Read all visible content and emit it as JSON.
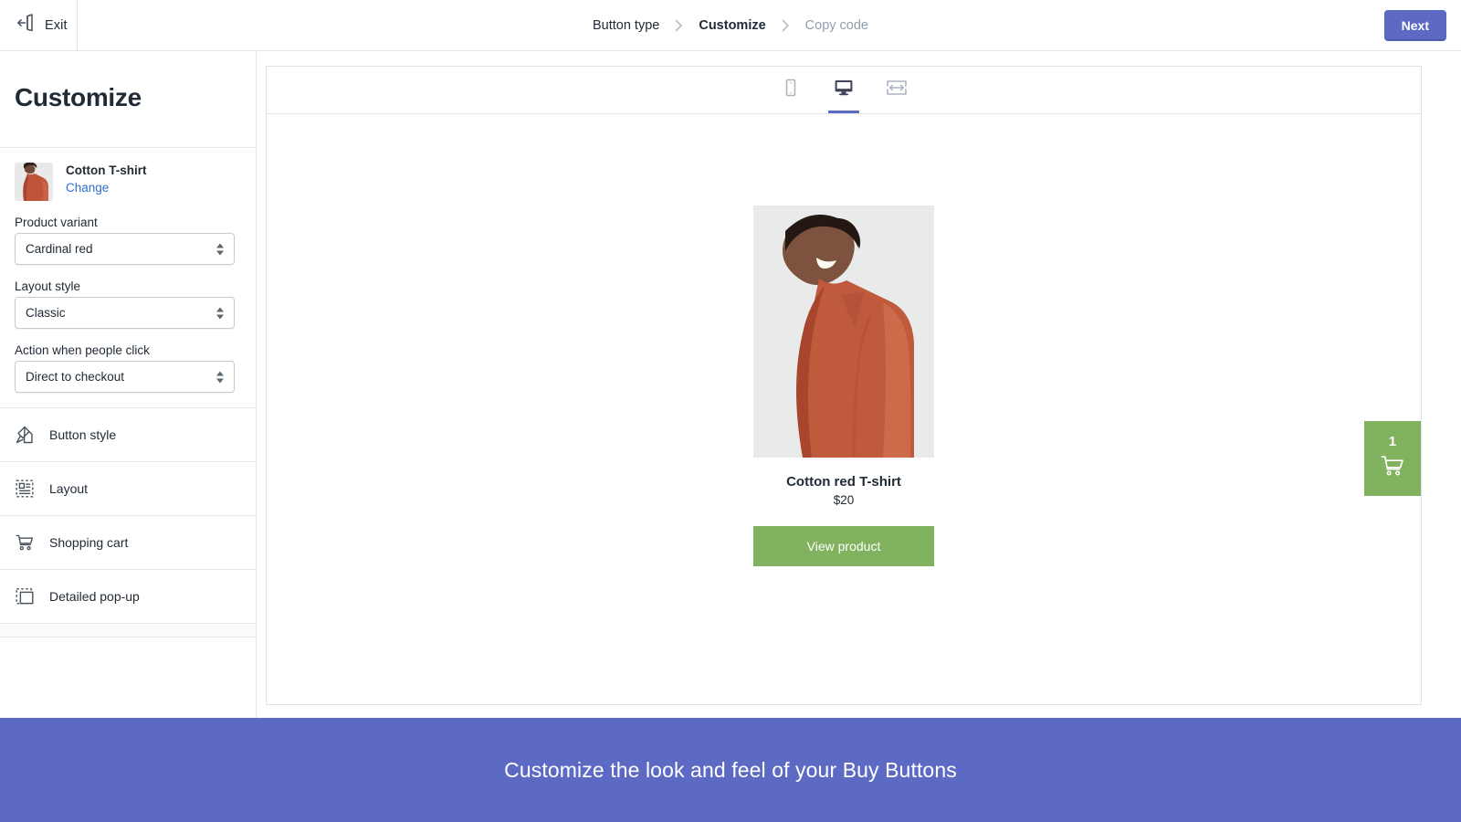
{
  "topbar": {
    "exit_label": "Exit",
    "exit_icon": "exit-door-arrow-icon",
    "next_label": "Next",
    "next_color": "#5c6ac4",
    "breadcrumb": [
      {
        "label": "Button type",
        "state": "done"
      },
      {
        "label": "Customize",
        "state": "active"
      },
      {
        "label": "Copy code",
        "state": "upcoming"
      }
    ],
    "separator": "›"
  },
  "sidebar": {
    "title": "Customize",
    "product": {
      "name": "Cotton T-shirt",
      "change_label": "Change",
      "thumbnail": "product-thumbnail"
    },
    "fields": [
      {
        "label": "Product variant",
        "value": "Cardinal red"
      },
      {
        "label": "Layout style",
        "value": "Classic"
      },
      {
        "label": "Action when people click",
        "value": "Direct to checkout"
      }
    ],
    "nav_items": [
      {
        "label": "Button style",
        "icon": "paint-brush-icon"
      },
      {
        "label": "Layout",
        "icon": "layout-grid-icon"
      },
      {
        "label": "Shopping cart",
        "icon": "shopping-cart-icon"
      },
      {
        "label": "Detailed pop-up",
        "icon": "popup-window-icon"
      }
    ]
  },
  "preview": {
    "view_modes": [
      {
        "name": "mobile",
        "icon": "mobile-device-icon",
        "active": false
      },
      {
        "name": "desktop",
        "icon": "desktop-monitor-icon",
        "active": true
      },
      {
        "name": "full-width",
        "icon": "full-width-arrows-icon",
        "active": false
      }
    ],
    "product": {
      "title": "Cotton red T-shirt",
      "price": "$20",
      "button_label": "View product",
      "button_color": "#80b25f",
      "image": "cotton-red-tshirt-photo"
    },
    "cart": {
      "count": "1",
      "icon": "shopping-cart-icon",
      "color": "#80b25f"
    }
  },
  "banner": {
    "text": "Customize the look and feel of your Buy Buttons",
    "color": "#5c6ac4"
  }
}
